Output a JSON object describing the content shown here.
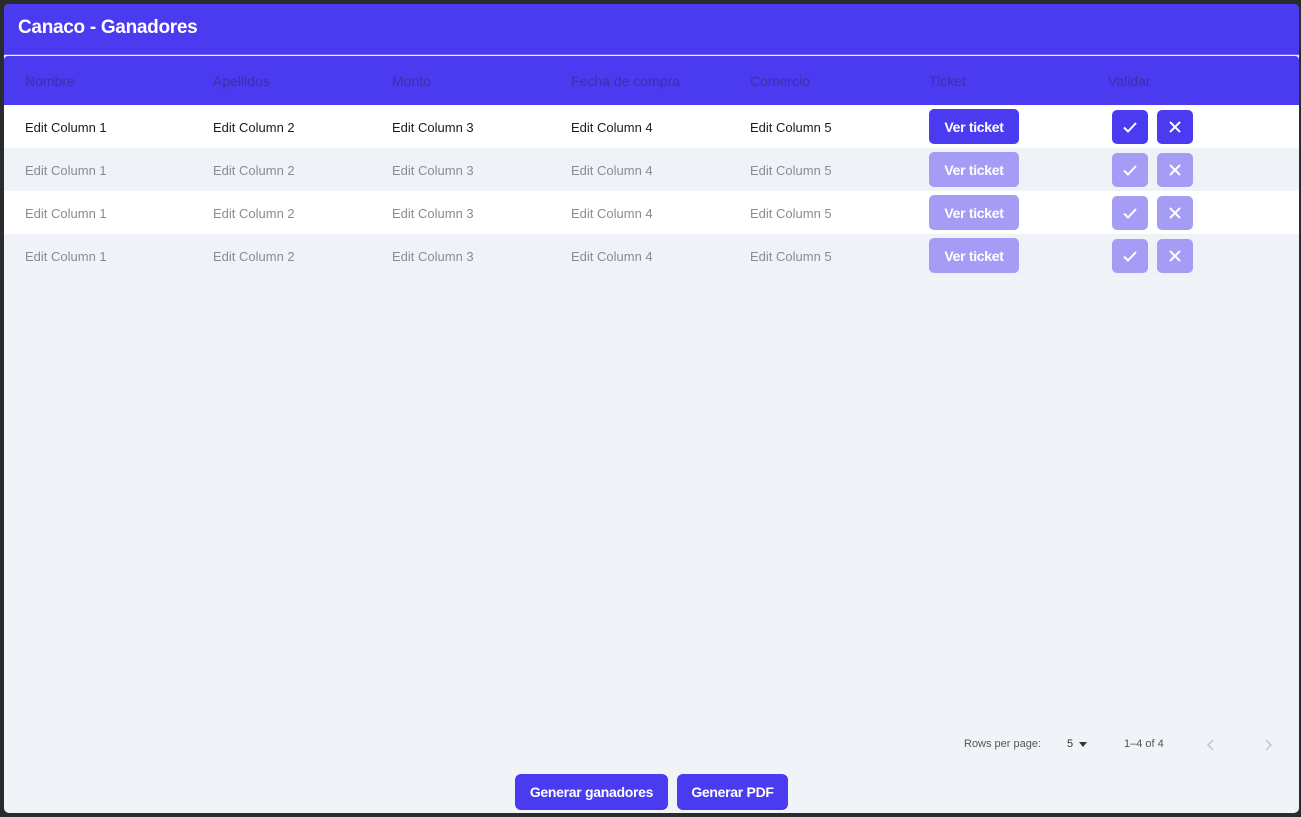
{
  "title": "Canaco - Ganadores",
  "columns": [
    "Nombre",
    "Apellidos",
    "Monto",
    "Fecha de compra",
    "Comercio",
    "Ticket",
    "Validar"
  ],
  "rows": [
    {
      "c1": "Edit Column 1",
      "c2": "Edit Column 2",
      "c3": "Edit Column 3",
      "c4": "Edit Column 4",
      "c5": "Edit Column 5",
      "ticket": "Ver ticket"
    },
    {
      "c1": "Edit Column 1",
      "c2": "Edit Column 2",
      "c3": "Edit Column 3",
      "c4": "Edit Column 4",
      "c5": "Edit Column 5",
      "ticket": "Ver ticket"
    },
    {
      "c1": "Edit Column 1",
      "c2": "Edit Column 2",
      "c3": "Edit Column 3",
      "c4": "Edit Column 4",
      "c5": "Edit Column 5",
      "ticket": "Ver ticket"
    },
    {
      "c1": "Edit Column 1",
      "c2": "Edit Column 2",
      "c3": "Edit Column 3",
      "c4": "Edit Column 4",
      "c5": "Edit Column 5",
      "ticket": "Ver ticket"
    }
  ],
  "pagination": {
    "rows_per_page_label": "Rows per page:",
    "rows_per_page": "5",
    "range": "1–4 of 4"
  },
  "footer": {
    "generate_winners": "Generar ganadores",
    "generate_pdf": "Generar PDF"
  },
  "icons": {
    "approve": "check-icon",
    "reject": "close-icon",
    "prev": "chevron-left-icon",
    "next": "chevron-right-icon"
  },
  "colors": {
    "accent": "#4a3af0",
    "accent_disabled": "#a59cf5",
    "background": "#f0f3f8"
  }
}
